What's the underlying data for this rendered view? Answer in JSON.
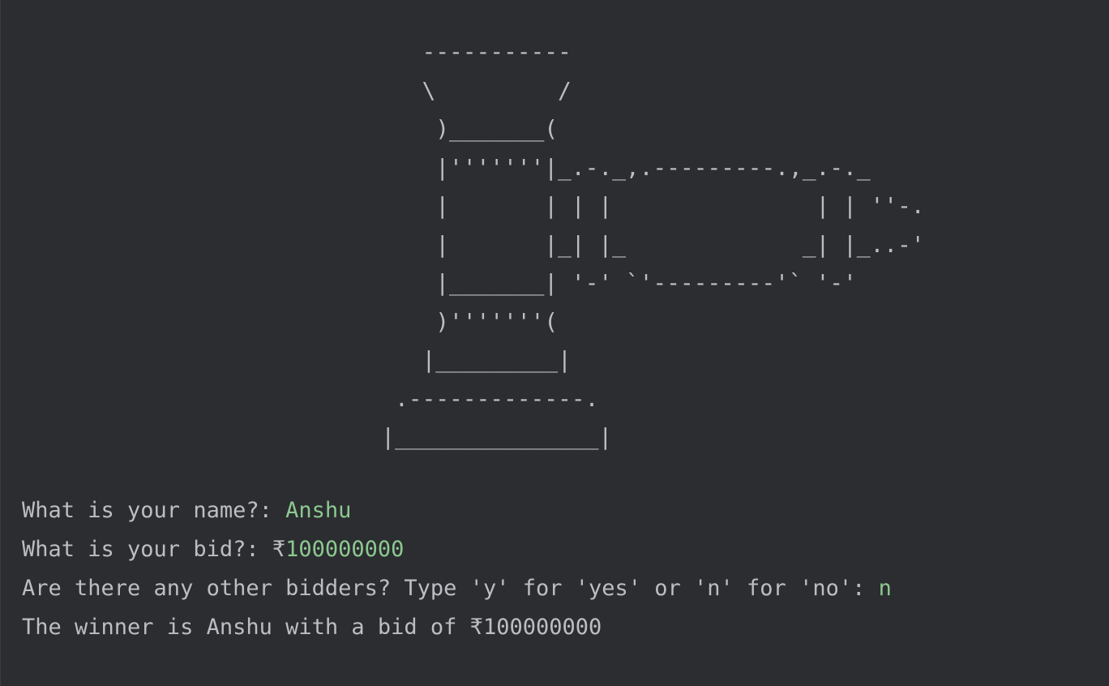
{
  "console": {
    "art": "                               -----------\n                               \\         /\n                                )_______(\n                                |'''''''|_.-._,.---------.,_.-._\n                                |       | | |               | | ''-.\n                                |       |_| |_             _| |_..-'\n                                |_______| '-' `'---------'` '-'\n                                )'''''''(\n                               |_________|\n                             .-------------.\n                            |_______________|",
    "lines": [
      {
        "prompt": "What is your name?: ",
        "input": "Anshu"
      },
      {
        "prompt": "What is your bid?: ₹",
        "input": "100000000"
      },
      {
        "prompt": "Are there any other bidders? Type 'y' for 'yes' or 'n' for 'no': ",
        "input": "n"
      },
      {
        "prompt": "The winner is Anshu with a bid of ₹100000000",
        "input": ""
      }
    ]
  },
  "colors": {
    "background": "#2b2d30",
    "text": "#bcbec4",
    "user_input": "#8dc891"
  }
}
